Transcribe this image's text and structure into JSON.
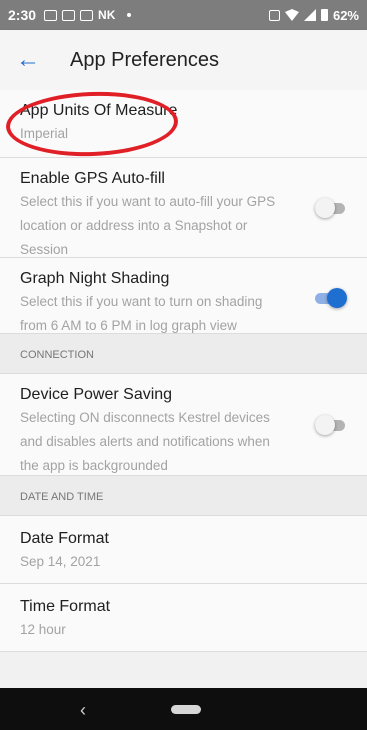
{
  "status_bar": {
    "time": "2:30",
    "notification_text": "NK",
    "battery": "62%"
  },
  "header": {
    "title": "App Preferences"
  },
  "settings": {
    "units": {
      "title": "App Units Of Measure",
      "value": "Imperial"
    },
    "gps": {
      "title": "Enable GPS Auto-fill",
      "description": "Select this if you want to auto-fill your GPS location or address into a Snapshot or Session",
      "enabled": false
    },
    "night_shading": {
      "title": "Graph Night Shading",
      "description": "Select this if you want to turn on shading from 6 AM to 6 PM in log graph view",
      "enabled": true
    },
    "connection_header": "CONNECTION",
    "power_saving": {
      "title": "Device Power Saving",
      "description": "Selecting ON disconnects Kestrel devices and disables alerts and notifications when the app is backgrounded",
      "enabled": false
    },
    "datetime_header": "DATE AND TIME",
    "date_format": {
      "title": "Date Format",
      "value": "Sep 14, 2021"
    },
    "time_format": {
      "title": "Time Format",
      "value": "12 hour"
    }
  },
  "colors": {
    "accent": "#1f6fd1",
    "highlight_annotation": "#e01f26"
  }
}
